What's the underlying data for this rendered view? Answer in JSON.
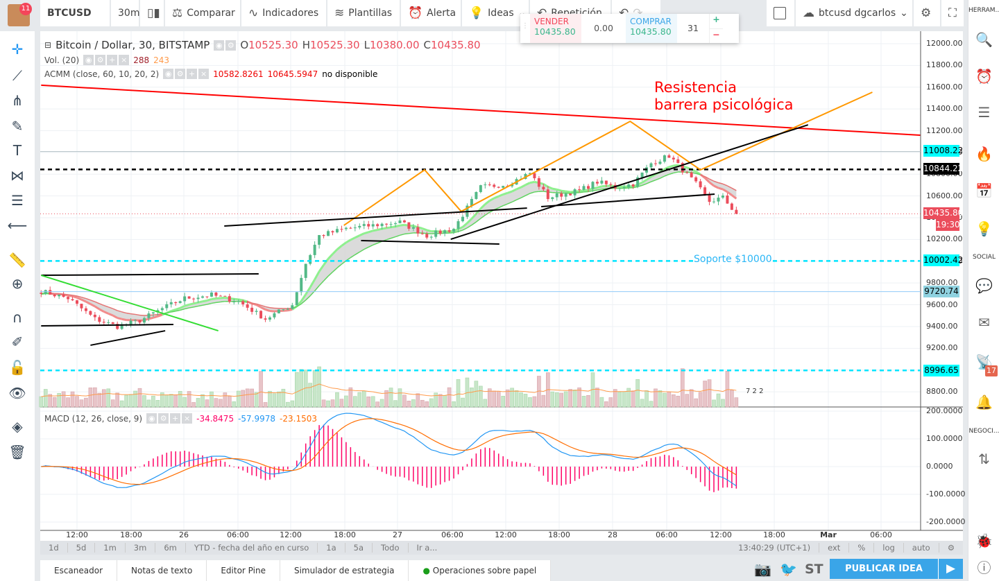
{
  "topbar": {
    "avatar_badge": "11",
    "symbol": "BTCUSD",
    "interval": "30m",
    "compare": "Comparar",
    "indicators": "Indicadores",
    "templates": "Plantillas",
    "alert": "Alerta",
    "ideas": "Ideas",
    "replay": "Repetición",
    "layout_name": "btcusd dgcarlos"
  },
  "trade": {
    "sell_label": "VENDER",
    "sell_price": "10435.80",
    "spread": "0.00",
    "buy_label": "COMPRAR",
    "buy_price": "10435.80",
    "quantity": "31",
    "plus": "+",
    "minus": "−"
  },
  "legend": {
    "title": "Bitcoin / Dollar, 30, BITSTAMP",
    "o_label": "O",
    "o": "10525.30",
    "h_label": "H",
    "h": "10525.30",
    "l_label": "L",
    "l": "10380.00",
    "c_label": "C",
    "c": "10435.80",
    "vol_name": "Vol. (20)",
    "vol_a": "288",
    "vol_b": "243",
    "acmm_name": "ACMM (close, 60, 10, 20, 2)",
    "acmm_a": "10582.8261",
    "acmm_b": "10645.5947",
    "acmm_c": "no disponible",
    "macd_name": "MACD (12, 26, close, 9)",
    "macd_a": "-34.8475",
    "macd_b": "-57.9978",
    "macd_c": "-23.1503"
  },
  "annotations": {
    "resistance_1": "Resistencia",
    "resistance_2": "barrera psicológica",
    "support": "Soporte $10000"
  },
  "price_axis": [
    "12000.00",
    "11800.00",
    "11600.00",
    "11400.00",
    "11200.00",
    "11000.00",
    "10800.00",
    "10600.00",
    "10400.00",
    "10200.00",
    "10000.00",
    "9800.00",
    "9600.00",
    "9400.00",
    "9200.00",
    "9000.00",
    "8800.00"
  ],
  "macd_axis": [
    "200.0000",
    "100.0000",
    "0.0000",
    "-100.0000",
    "-200.0000"
  ],
  "price_labels": {
    "l11008": "11008.22",
    "l10844": "10844.22",
    "last": "10435.80",
    "countdown": "19:30",
    "l10002": "10002.42",
    "l9720": "9720.74",
    "l8996": "8996.65"
  },
  "time_axis": [
    "12:00",
    "18:00",
    "26",
    "06:00",
    "12:00",
    "18:00",
    "27",
    "06:00",
    "12:00",
    "18:00",
    "28",
    "06:00",
    "12:00",
    "18:00",
    "Mar",
    "06:00"
  ],
  "events_label": "7 2 2",
  "range_bar": [
    "1d",
    "5d",
    "1m",
    "3m",
    "6m",
    "YTD - fecha del año en curso",
    "1a",
    "5a",
    "Todo",
    "Ir a..."
  ],
  "status": {
    "clock": "13:40:29 (UTC+1)",
    "ext": "ext",
    "pct": "%",
    "log": "log",
    "auto": "auto"
  },
  "bottom_tabs": [
    "Escaneador",
    "Notas de texto",
    "Editor Pine",
    "Simulador de estrategia",
    "Operaciones sobre papel"
  ],
  "publish": "PUBLICAR IDEA",
  "share_st": "ST",
  "right_sidebar": {
    "tools": "HERRAM...",
    "social": "SOCIAL",
    "trading": "NEGOCI...",
    "badge": "17"
  },
  "colors": {
    "up": "#53b987",
    "down": "#eb4d5c",
    "resistance": "#ff0000",
    "zigzag": "#ff9800",
    "support": "#00e5ff",
    "macd": "#2196f3",
    "signal": "#ff6d00",
    "hist": "#ff0066",
    "accent": "#3aa5e8"
  },
  "chart_data": {
    "type": "candlestick",
    "symbol": "BTCUSD",
    "interval": "30m",
    "ylim": [
      8700,
      12100
    ],
    "price_path": [
      [
        "2018-02-25 08:00",
        9725
      ],
      [
        "2018-02-25 11:00",
        9660
      ],
      [
        "2018-02-25 14:00",
        9470
      ],
      [
        "2018-02-25 16:30",
        9400
      ],
      [
        "2018-02-25 19:00",
        9455
      ],
      [
        "2018-02-25 21:30",
        9565
      ],
      [
        "2018-02-26 00:00",
        9660
      ],
      [
        "2018-02-26 03:00",
        9690
      ],
      [
        "2018-02-26 06:00",
        9630
      ],
      [
        "2018-02-26 09:00",
        9470
      ],
      [
        "2018-02-26 12:00",
        9600
      ],
      [
        "2018-02-26 13:30",
        9980
      ],
      [
        "2018-02-26 15:00",
        10235
      ],
      [
        "2018-02-26 18:00",
        10300
      ],
      [
        "2018-02-26 21:00",
        10330
      ],
      [
        "2018-02-27 00:00",
        10360
      ],
      [
        "2018-02-27 03:00",
        10235
      ],
      [
        "2018-02-27 06:00",
        10300
      ],
      [
        "2018-02-27 09:00",
        10680
      ],
      [
        "2018-02-27 12:00",
        10710
      ],
      [
        "2018-02-27 14:30",
        10810
      ],
      [
        "2018-02-27 16:30",
        10585
      ],
      [
        "2018-02-27 20:00",
        10650
      ],
      [
        "2018-02-27 22:00",
        10730
      ],
      [
        "2018-02-28 00:00",
        10680
      ],
      [
        "2018-02-28 02:00",
        10710
      ],
      [
        "2018-02-28 04:00",
        10900
      ],
      [
        "2018-02-28 06:00",
        10970
      ],
      [
        "2018-02-28 07:30",
        10840
      ],
      [
        "2018-02-28 09:00",
        10710
      ],
      [
        "2018-02-28 10:30",
        10550
      ],
      [
        "2018-02-28 12:00",
        10585
      ],
      [
        "2018-02-28 13:30",
        10436
      ]
    ],
    "drawings": [
      {
        "name": "resistance-line",
        "color": "#ff0000",
        "points": [
          [
            "2018-02-25 08:00",
            11618
          ],
          [
            "2018-03-01 10:00",
            11159
          ]
        ]
      },
      {
        "name": "zigzag-line",
        "color": "#ff9800",
        "points": [
          [
            "2018-02-26 17:45",
            10330
          ],
          [
            "2018-02-27 02:45",
            10840
          ],
          [
            "2018-02-27 06:50",
            10458
          ],
          [
            "2018-02-28 01:40",
            11286
          ],
          [
            "2018-02-28 09:30",
            10840
          ],
          [
            "2018-03-01 04:40",
            11554
          ]
        ]
      },
      {
        "name": "trendline",
        "color": "#000000",
        "points": [
          [
            "2018-02-25 08:00",
            9871
          ],
          [
            "2018-02-26 08:15",
            9884
          ]
        ]
      },
      {
        "name": "trendline",
        "color": "#000000",
        "points": [
          [
            "2018-02-25 08:00",
            9406
          ],
          [
            "2018-02-25 22:45",
            9419
          ]
        ]
      },
      {
        "name": "trendline",
        "color": "#000000",
        "points": [
          [
            "2018-02-25 13:30",
            9228
          ],
          [
            "2018-02-25 21:50",
            9361
          ]
        ]
      },
      {
        "name": "trendline",
        "color": "#000000",
        "points": [
          [
            "2018-02-26 04:25",
            10324
          ],
          [
            "2018-02-27 14:10",
            10489
          ]
        ]
      },
      {
        "name": "trendline",
        "color": "#000000",
        "points": [
          [
            "2018-02-26 19:40",
            10190
          ],
          [
            "2018-02-27 11:05",
            10158
          ]
        ]
      },
      {
        "name": "trendline",
        "color": "#000000",
        "points": [
          [
            "2018-02-27 05:40",
            10202
          ],
          [
            "2018-02-28 21:30",
            11254
          ]
        ]
      },
      {
        "name": "trendline",
        "color": "#000000",
        "points": [
          [
            "2018-02-27 15:45",
            10502
          ],
          [
            "2018-02-28 11:05",
            10617
          ]
        ]
      },
      {
        "name": "green-trendline",
        "color": "#33dd33",
        "points": [
          [
            "2018-02-25 08:00",
            9871
          ],
          [
            "2018-02-26 03:45",
            9361
          ]
        ]
      }
    ],
    "horizontal_levels": [
      {
        "price": 10844.22,
        "style": "dashed",
        "color": "#000000"
      },
      {
        "price": 10002.42,
        "style": "dashed",
        "color": "#00e5ff"
      },
      {
        "price": 8996.65,
        "style": "dashed",
        "color": "#00e5ff"
      },
      {
        "price": 11008.22,
        "style": "solid",
        "color": "#b0bec5"
      },
      {
        "price": 9720.74,
        "style": "solid",
        "color": "#90caf9"
      }
    ],
    "macd_ylim": [
      -200,
      200
    ]
  }
}
